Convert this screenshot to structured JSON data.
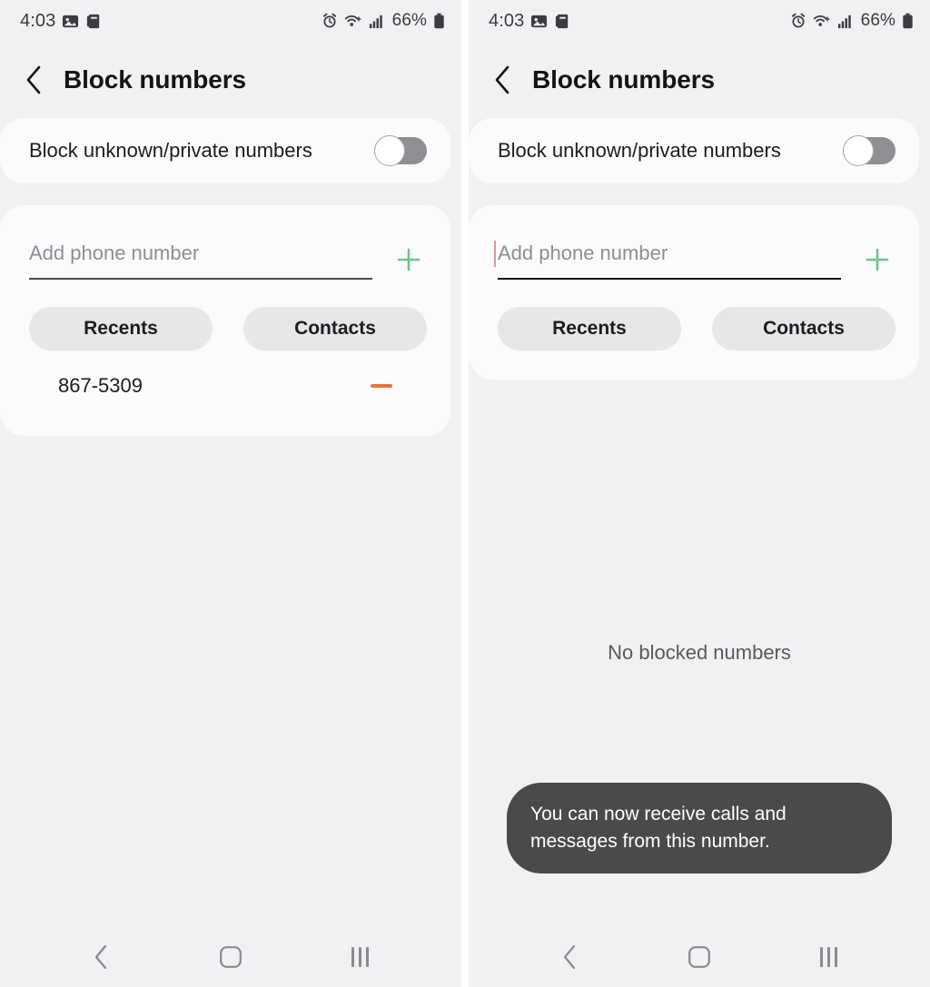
{
  "status_bar": {
    "time": "4:03",
    "battery_percent": "66%",
    "left_icons": [
      "gallery-icon",
      "app-icon"
    ],
    "right_icons": [
      "alarm-icon",
      "wifi-icon",
      "signal-icon",
      "battery-icon"
    ]
  },
  "header": {
    "title": "Block numbers",
    "back_icon": "back-chevron-icon"
  },
  "toggle_setting": {
    "label": "Block unknown/private numbers",
    "state": "off"
  },
  "add_number": {
    "placeholder": "Add phone number",
    "value": "",
    "add_icon": "plus-icon",
    "chips": [
      {
        "label": "Recents"
      },
      {
        "label": "Contacts"
      }
    ]
  },
  "left_panel": {
    "blocked_numbers": [
      {
        "number": "867-5309",
        "remove_icon": "minus-icon"
      }
    ]
  },
  "right_panel": {
    "empty_state": "No blocked numbers",
    "toast": "You can now receive calls and messages from this number.",
    "field_focused": true
  },
  "nav_bar": {
    "back_label": "back-icon",
    "home_label": "home-icon",
    "recents_label": "recents-icon"
  },
  "colors": {
    "panel_bg": "#f1f0f2",
    "card_bg": "#fbfafc",
    "chip_bg": "#e7e6e9",
    "accent_add": "#6ec48a",
    "accent_remove": "#e8743c",
    "toast_bg": "#4a4a4c",
    "switch_track": "#8e8e93",
    "text_primary": "#1d1d1f",
    "text_secondary": "#8e8e93"
  }
}
